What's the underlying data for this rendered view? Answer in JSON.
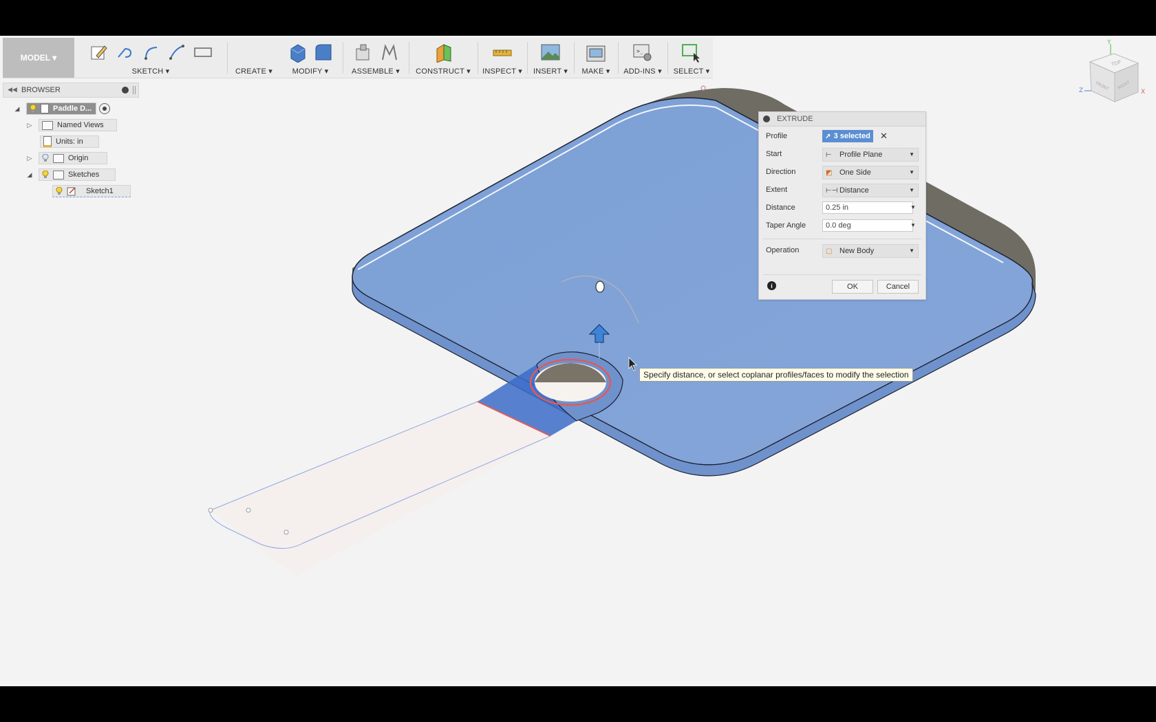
{
  "toolbar": {
    "model_label": "MODEL ▾",
    "groups": {
      "sketch": "SKETCH ▾",
      "create": "CREATE ▾",
      "modify": "MODIFY ▾",
      "assemble": "ASSEMBLE ▾",
      "construct": "CONSTRUCT ▾",
      "inspect": "INSPECT ▾",
      "insert": "INSERT ▾",
      "make": "MAKE ▾",
      "addins": "ADD-INS ▾",
      "select": "SELECT ▾"
    }
  },
  "browser": {
    "title": "BROWSER",
    "root": "Paddle D...",
    "items": {
      "named_views": "Named Views",
      "units": "Units: in",
      "origin": "Origin",
      "sketches": "Sketches",
      "sketch1": "Sketch1"
    }
  },
  "extrude": {
    "title": "EXTRUDE",
    "profile_label": "Profile",
    "profile_value": "3 selected",
    "start_label": "Start",
    "start_value": "Profile Plane",
    "direction_label": "Direction",
    "direction_value": "One Side",
    "extent_label": "Extent",
    "extent_value": "Distance",
    "distance_label": "Distance",
    "distance_value": "0.25 in",
    "taper_label": "Taper Angle",
    "taper_value": "0.0 deg",
    "operation_label": "Operation",
    "operation_value": "New Body",
    "ok": "OK",
    "cancel": "Cancel"
  },
  "tooltip": "Specify distance, or select coplanar profiles/faces to modify the selection",
  "viewcube": {
    "top": "TOP",
    "front": "FRONT",
    "right": "RIGHT",
    "x": "X",
    "y": "Y",
    "z": "Z"
  },
  "colors": {
    "body_blue": "#7ea0d4",
    "body_edge": "#6e6b60",
    "selection_chip": "#5b8ed2",
    "highlight_red": "#e05a5a"
  }
}
